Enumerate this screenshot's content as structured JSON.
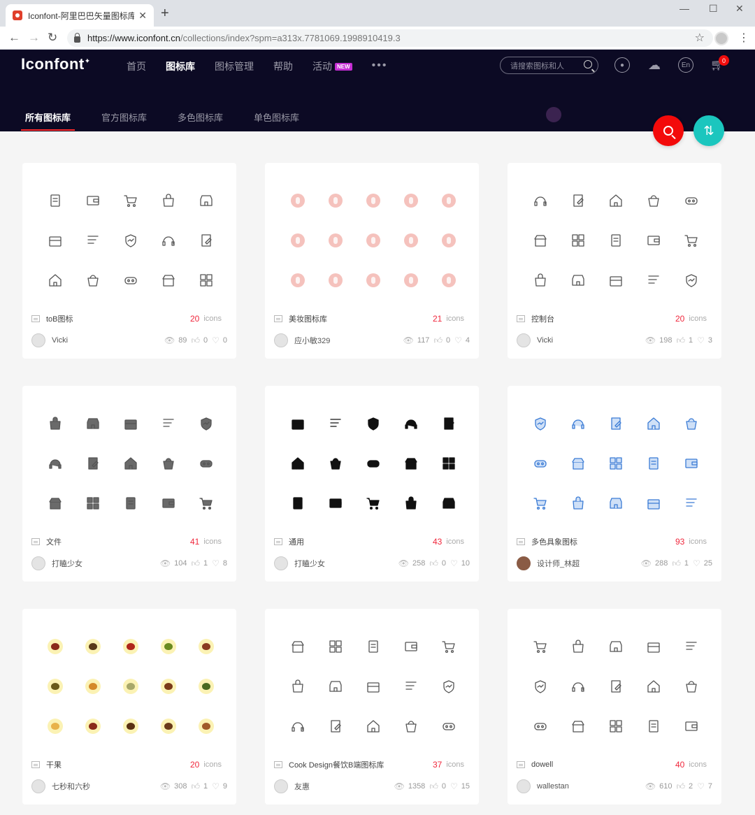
{
  "browser": {
    "tab_title": "Iconfont-阿里巴巴矢量图标库",
    "url_main": "https://www.iconfont.cn",
    "url_rest": "/collections/index?spm=a313x.7781069.1998910419.3"
  },
  "header": {
    "logo": "Iconfont",
    "nav": [
      "首页",
      "图标库",
      "图标管理",
      "帮助",
      "活动"
    ],
    "new_badge": "NEW",
    "search_placeholder": "请搜索图标和人",
    "cart_count": "0",
    "lang": "En",
    "tabs": [
      "所有图标库",
      "官方图标库",
      "多色图标库",
      "单色图标库"
    ]
  },
  "colors": {
    "brand_dark": "#0c0a24",
    "accent_red": "#f30a0a",
    "accent_teal": "#1bc6be",
    "count_red": "#f0273c"
  },
  "icons_word": "icons",
  "cards": [
    {
      "name": "toB图标",
      "count": "20",
      "author": "Vicki",
      "views": "89",
      "likes": "0",
      "favs": "0",
      "style": "outline"
    },
    {
      "name": "美妆图标库",
      "count": "21",
      "author": "应小敏329",
      "views": "117",
      "likes": "0",
      "favs": "4",
      "style": "pink"
    },
    {
      "name": "控制台",
      "count": "20",
      "author": "Vicki",
      "views": "198",
      "likes": "1",
      "favs": "3",
      "style": "outline"
    },
    {
      "name": "文件",
      "count": "41",
      "author": "打瞌少女",
      "views": "104",
      "likes": "1",
      "favs": "8",
      "style": "gray"
    },
    {
      "name": "通用",
      "count": "43",
      "author": "打瞌少女",
      "views": "258",
      "likes": "0",
      "favs": "10",
      "style": "black"
    },
    {
      "name": "多色具象图标",
      "count": "93",
      "author": "设计师_林超",
      "views": "288",
      "likes": "1",
      "favs": "25",
      "style": "blue"
    },
    {
      "name": "干果",
      "count": "20",
      "author": "七秒和六秒",
      "views": "308",
      "likes": "1",
      "favs": "9",
      "style": "fruit"
    },
    {
      "name": "Cook Design餐饮B端图标库",
      "count": "37",
      "author": "友惠",
      "views": "1358",
      "likes": "0",
      "favs": "15",
      "style": "outline"
    },
    {
      "name": "dowell",
      "count": "40",
      "author": "wallestan",
      "views": "610",
      "likes": "2",
      "favs": "7",
      "style": "outline"
    }
  ]
}
